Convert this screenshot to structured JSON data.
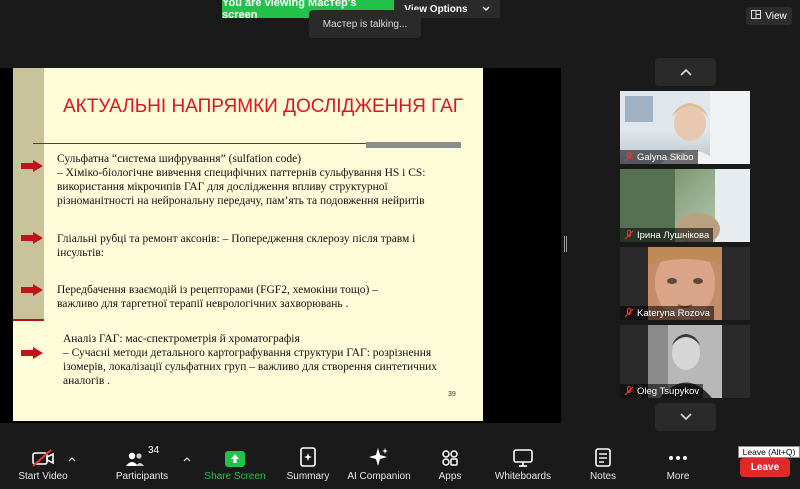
{
  "banner": {
    "viewing_text": "You are viewing Мастер's screen",
    "view_options": "View Options"
  },
  "talking": "Мастер is talking...",
  "view_button": "View",
  "slide": {
    "title": "АКТУАЛЬНІ НАПРЯМКИ ДОСЛІДЖЕННЯ ГАГ",
    "page_number": "39",
    "blocks": [
      {
        "lines": [
          "Сульфатна “система шифрування” (sulfation code)",
          "– Хіміко-біологічне вивчення специфічних паттернів сульфування HS і CS:",
          "використання мікрочипів ГАГ для дослідження впливу структурної",
          "різноманітності на нейрональну передачу, пам’ять та подовження нейритів"
        ]
      },
      {
        "lines": [
          "Гліальні рубці та ремонт аксонів: – Попередження склерозу після травм і",
          "інсультів:"
        ]
      },
      {
        "lines": [
          "Передбачення взаємодій із рецепторами (FGF2, хемокіни тощо) –",
          "важливо для таргетної терапії неврологічних захворювань ."
        ]
      },
      {
        "lines": [
          "Аналіз ГАГ: мас-спектрометрія й хроматографія",
          "– Сучасні методи детального картографування структури ГАГ: розрізнення",
          "ізомерів, локалізації сульфатних груп – важливо для створення синтетичних",
          "аналогів ."
        ]
      }
    ]
  },
  "participants": [
    {
      "name": "Galyna Skibo"
    },
    {
      "name": "Ірина Лушнікова"
    },
    {
      "name": "Kateryna Rozova"
    },
    {
      "name": "Oleg Tsupykov"
    }
  ],
  "toolbar": {
    "start_video": "Start Video",
    "participants": "Participants",
    "participant_count": "34",
    "share_screen": "Share Screen",
    "summary": "Summary",
    "ai_companion": "AI Companion",
    "apps": "Apps",
    "whiteboards": "Whiteboards",
    "notes": "Notes",
    "more": "More",
    "leave": "Leave",
    "leave_tooltip": "Leave (Alt+Q)"
  },
  "colors": {
    "accent_green": "#23c14a",
    "leave_red": "#e02a2a",
    "slide_title_red": "#e0141e",
    "slide_bg": "#fdfbd8"
  }
}
